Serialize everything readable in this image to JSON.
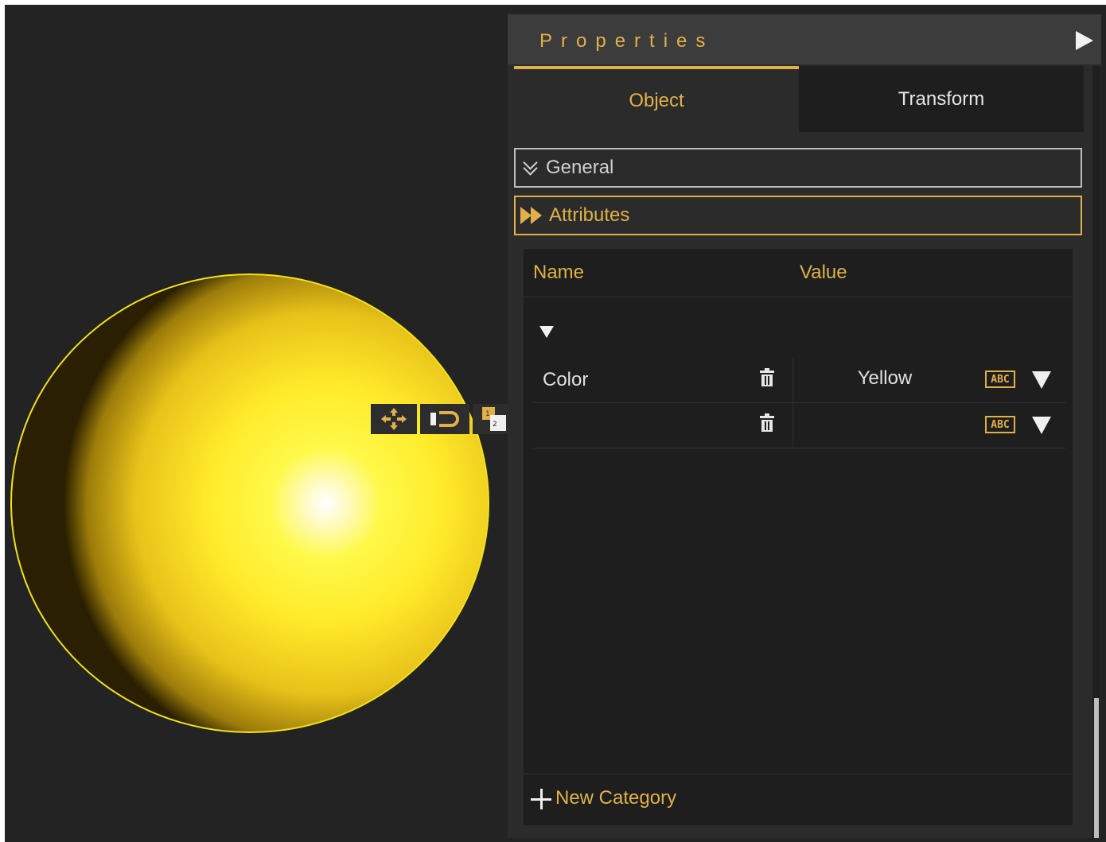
{
  "panel": {
    "title": "Properties",
    "tabs": [
      {
        "label": "Object",
        "active": true
      },
      {
        "label": "Transform",
        "active": false
      }
    ],
    "sections": {
      "general": "General",
      "attributes": "Attributes"
    },
    "attributes_table": {
      "headers": {
        "name": "Name",
        "value": "Value"
      },
      "rows": [
        {
          "name": "Color",
          "value": "Yellow",
          "type_icon": "ABC"
        },
        {
          "name": "",
          "value": "",
          "type_icon": "ABC"
        }
      ],
      "new_category_label": "New Category"
    }
  },
  "viewport": {
    "object": "sphere",
    "colors": {
      "sphere": "#ffea2a",
      "selection_outline": "#f2e21a",
      "accent": "#e0b14a",
      "background": "#232323"
    }
  },
  "gizmo": {
    "tools": [
      "move-icon",
      "snap-magnet-icon",
      "order-icon",
      "arrow-up-icon",
      "arrow-down-icon",
      "material-icon"
    ]
  }
}
